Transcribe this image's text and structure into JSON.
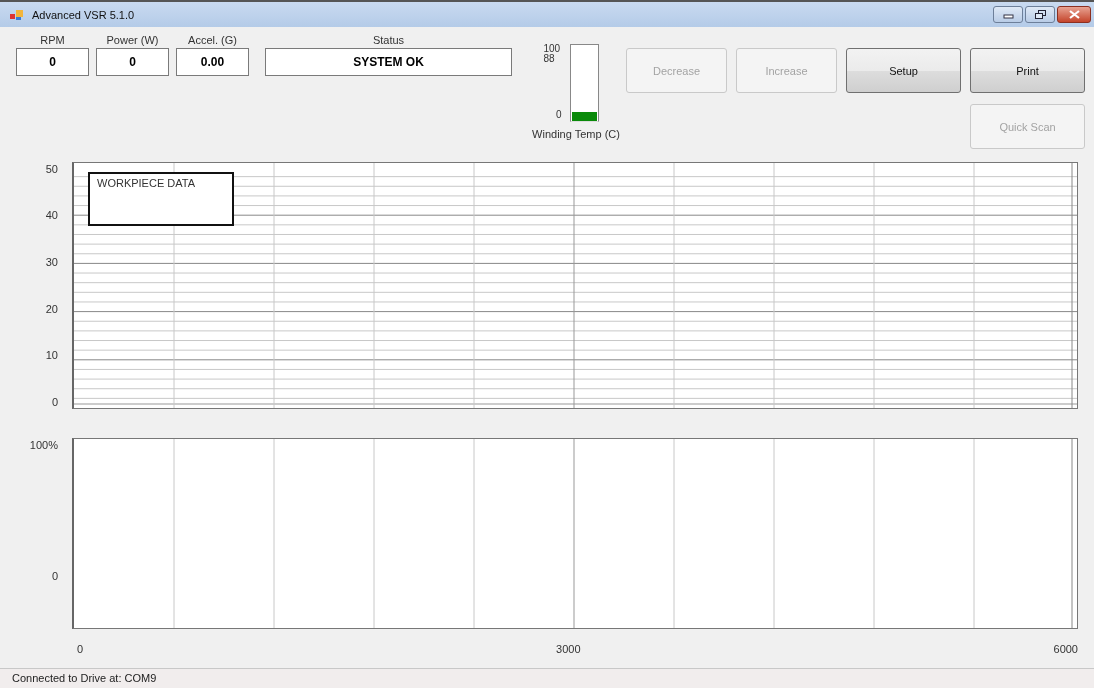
{
  "window": {
    "title": "Advanced VSR 5.1.0"
  },
  "readouts": [
    {
      "label": "RPM",
      "value": "0"
    },
    {
      "label": "Power (W)",
      "value": "0"
    },
    {
      "label": "Accel. (G)",
      "value": "0.00"
    }
  ],
  "status": {
    "label": "Status",
    "value": "SYSTEM OK"
  },
  "temperature_gauge": {
    "scale": [
      "100",
      "88",
      "0"
    ],
    "level": 0.12,
    "caption": "Winding Temp (C)"
  },
  "buttons": [
    {
      "label": "Decrease",
      "disabled": true
    },
    {
      "label": "Increase",
      "disabled": true
    },
    {
      "label": "Setup",
      "disabled": false
    },
    {
      "label": "Print",
      "disabled": false
    },
    {
      "label": "Quick Scan",
      "disabled": true
    }
  ],
  "amplitude_chart": {
    "y_labels": [
      "50",
      "40",
      "30",
      "20",
      "10",
      "0"
    ],
    "legend": "WORKPIECE DATA"
  },
  "response_chart": {
    "y_labels": [
      "100%",
      "0"
    ]
  },
  "x_axis_labels": [
    "0",
    "3000",
    "6000"
  ],
  "status_bar": "Connected to Drive at: COM9"
}
